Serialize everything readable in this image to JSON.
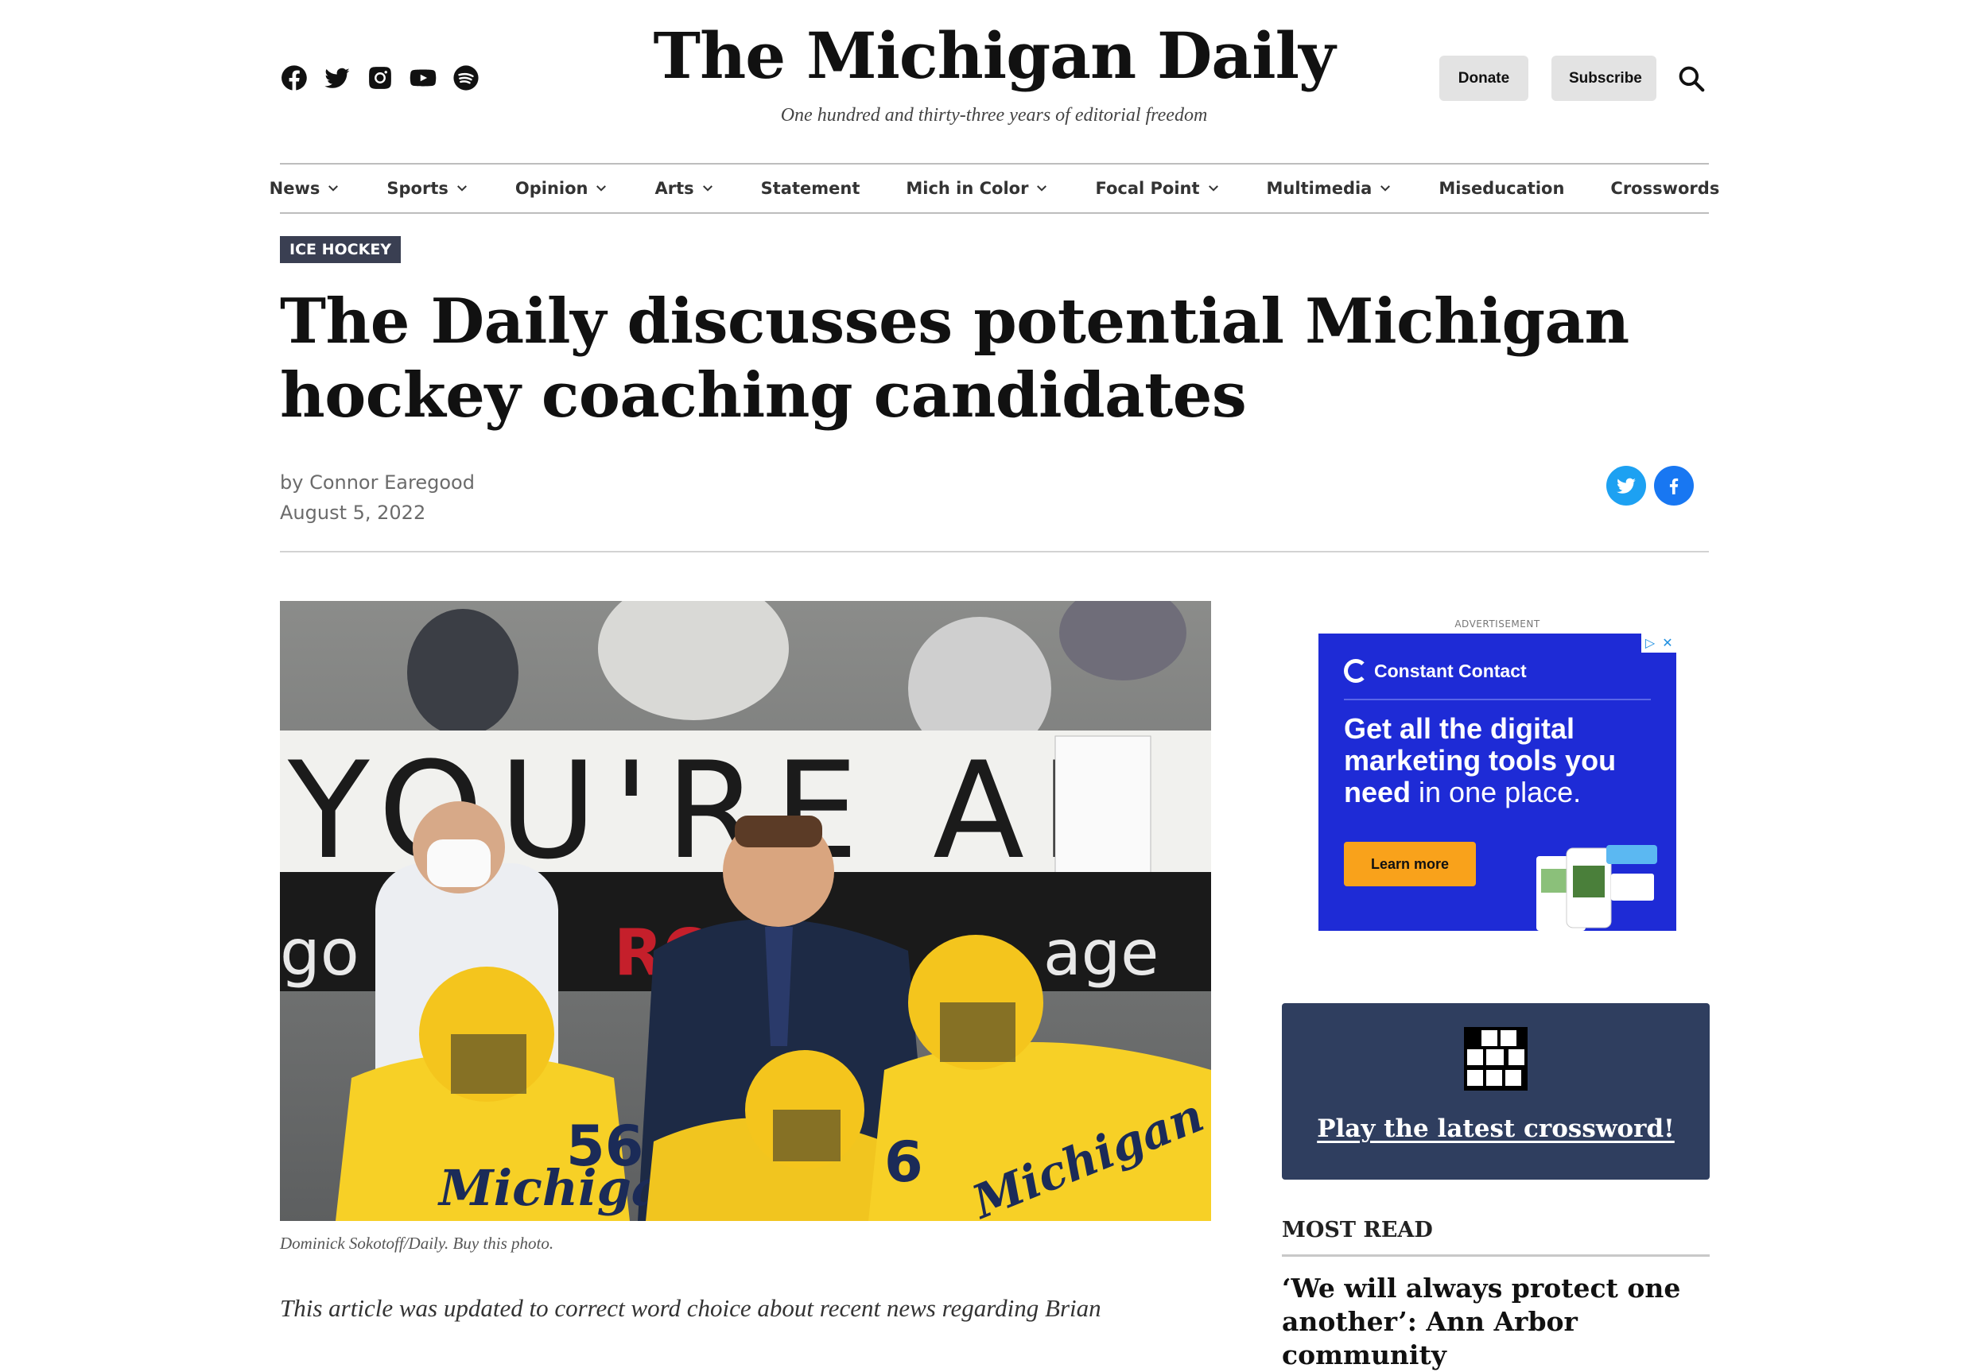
{
  "header": {
    "social": [
      {
        "name": "facebook-icon"
      },
      {
        "name": "twitter-icon"
      },
      {
        "name": "instagram-icon"
      },
      {
        "name": "youtube-icon"
      },
      {
        "name": "spotify-icon"
      }
    ],
    "masthead": "The Michigan Daily",
    "tagline": "One hundred and thirty-three years of editorial freedom",
    "donate_label": "Donate",
    "subscribe_label": "Subscribe",
    "search_icon": "search-icon"
  },
  "nav": {
    "items": [
      {
        "label": "News",
        "dropdown": true
      },
      {
        "label": "Sports",
        "dropdown": true
      },
      {
        "label": "Opinion",
        "dropdown": true
      },
      {
        "label": "Arts",
        "dropdown": true
      },
      {
        "label": "Statement",
        "dropdown": false
      },
      {
        "label": "Mich in Color",
        "dropdown": true
      },
      {
        "label": "Focal Point",
        "dropdown": true
      },
      {
        "label": "Multimedia",
        "dropdown": true
      },
      {
        "label": "Miseducation",
        "dropdown": false
      },
      {
        "label": "Crosswords",
        "dropdown": false
      }
    ]
  },
  "article": {
    "category": "ICE HOCKEY",
    "headline": "The Daily discusses potential Michigan hockey coaching candidates",
    "byline": "by Connor Earegood",
    "date": "August 5, 2022",
    "photo": {
      "banner_text": "YOU'RE AM",
      "caption": "Dominick Sokotoff/Daily. Buy this photo."
    },
    "body_start": "This article was updated to correct word choice about recent news regarding Brian"
  },
  "share": {
    "twitter": "twitter-icon",
    "facebook": "facebook-icon"
  },
  "sidebar": {
    "ad_label": "ADVERTISEMENT",
    "ad": {
      "brand": "Constant Contact",
      "headline_bold": "Get all the digital marketing tools you need",
      "headline_rest": " in one place.",
      "cta": "Learn more",
      "bg_color": "#1e2bd6",
      "cta_color": "#f9a21b"
    },
    "crossword": {
      "link": "Play the latest crossword!",
      "bg_color": "#2f3e5f"
    },
    "most_read": {
      "title": "MOST READ",
      "first_item": "‘We will always protect one another’: Ann Arbor community"
    }
  },
  "colors": {
    "kicker_bg": "#3a3f52",
    "twitter": "#1da1f2",
    "facebook": "#1877f2"
  }
}
